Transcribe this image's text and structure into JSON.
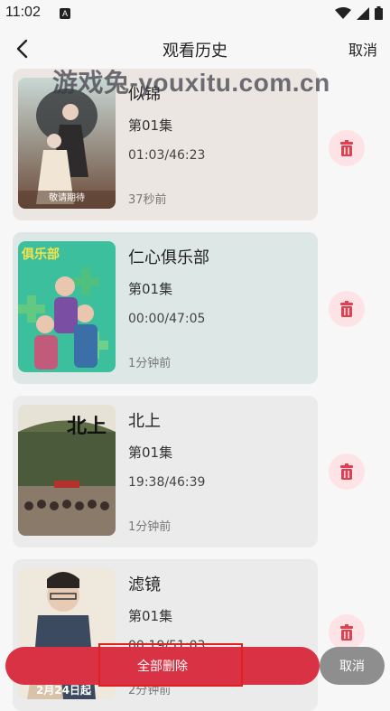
{
  "status": {
    "time": "11:02",
    "app_icon": "A"
  },
  "header": {
    "title": "观看历史",
    "cancel_label": "取消"
  },
  "watermark": "游戏兔-youxitu.com.cn",
  "items": [
    {
      "title": "似锦",
      "episode": "第01集",
      "progress": "01:03/46:23",
      "ago": "37秒前",
      "poster_text": "敬请期待",
      "bg": "#ece6e2"
    },
    {
      "title": "仁心俱乐部",
      "episode": "第01集",
      "progress": "00:00/47:05",
      "ago": "1分钟前",
      "poster_text": "俱乐部",
      "bg": "#dde8e6"
    },
    {
      "title": "北上",
      "episode": "第01集",
      "progress": "19:38/46:39",
      "ago": "1分钟前",
      "poster_text": "北上",
      "bg": "#ebebeb"
    },
    {
      "title": "滤镜",
      "episode": "第01集",
      "progress": "00:19/51:03",
      "ago": "2分钟前",
      "poster_text": "2月24日起",
      "bg": "#ebebeb"
    }
  ],
  "bottom": {
    "delete_all_label": "全部删除",
    "cancel_label": "取消"
  },
  "colors": {
    "accent": "#d93244",
    "delete_icon": "#e04050",
    "delete_bg": "#fde3e6"
  },
  "icons": [
    "back-arrow-icon",
    "trash-icon",
    "wifi-icon",
    "signal-icon",
    "battery-icon"
  ]
}
